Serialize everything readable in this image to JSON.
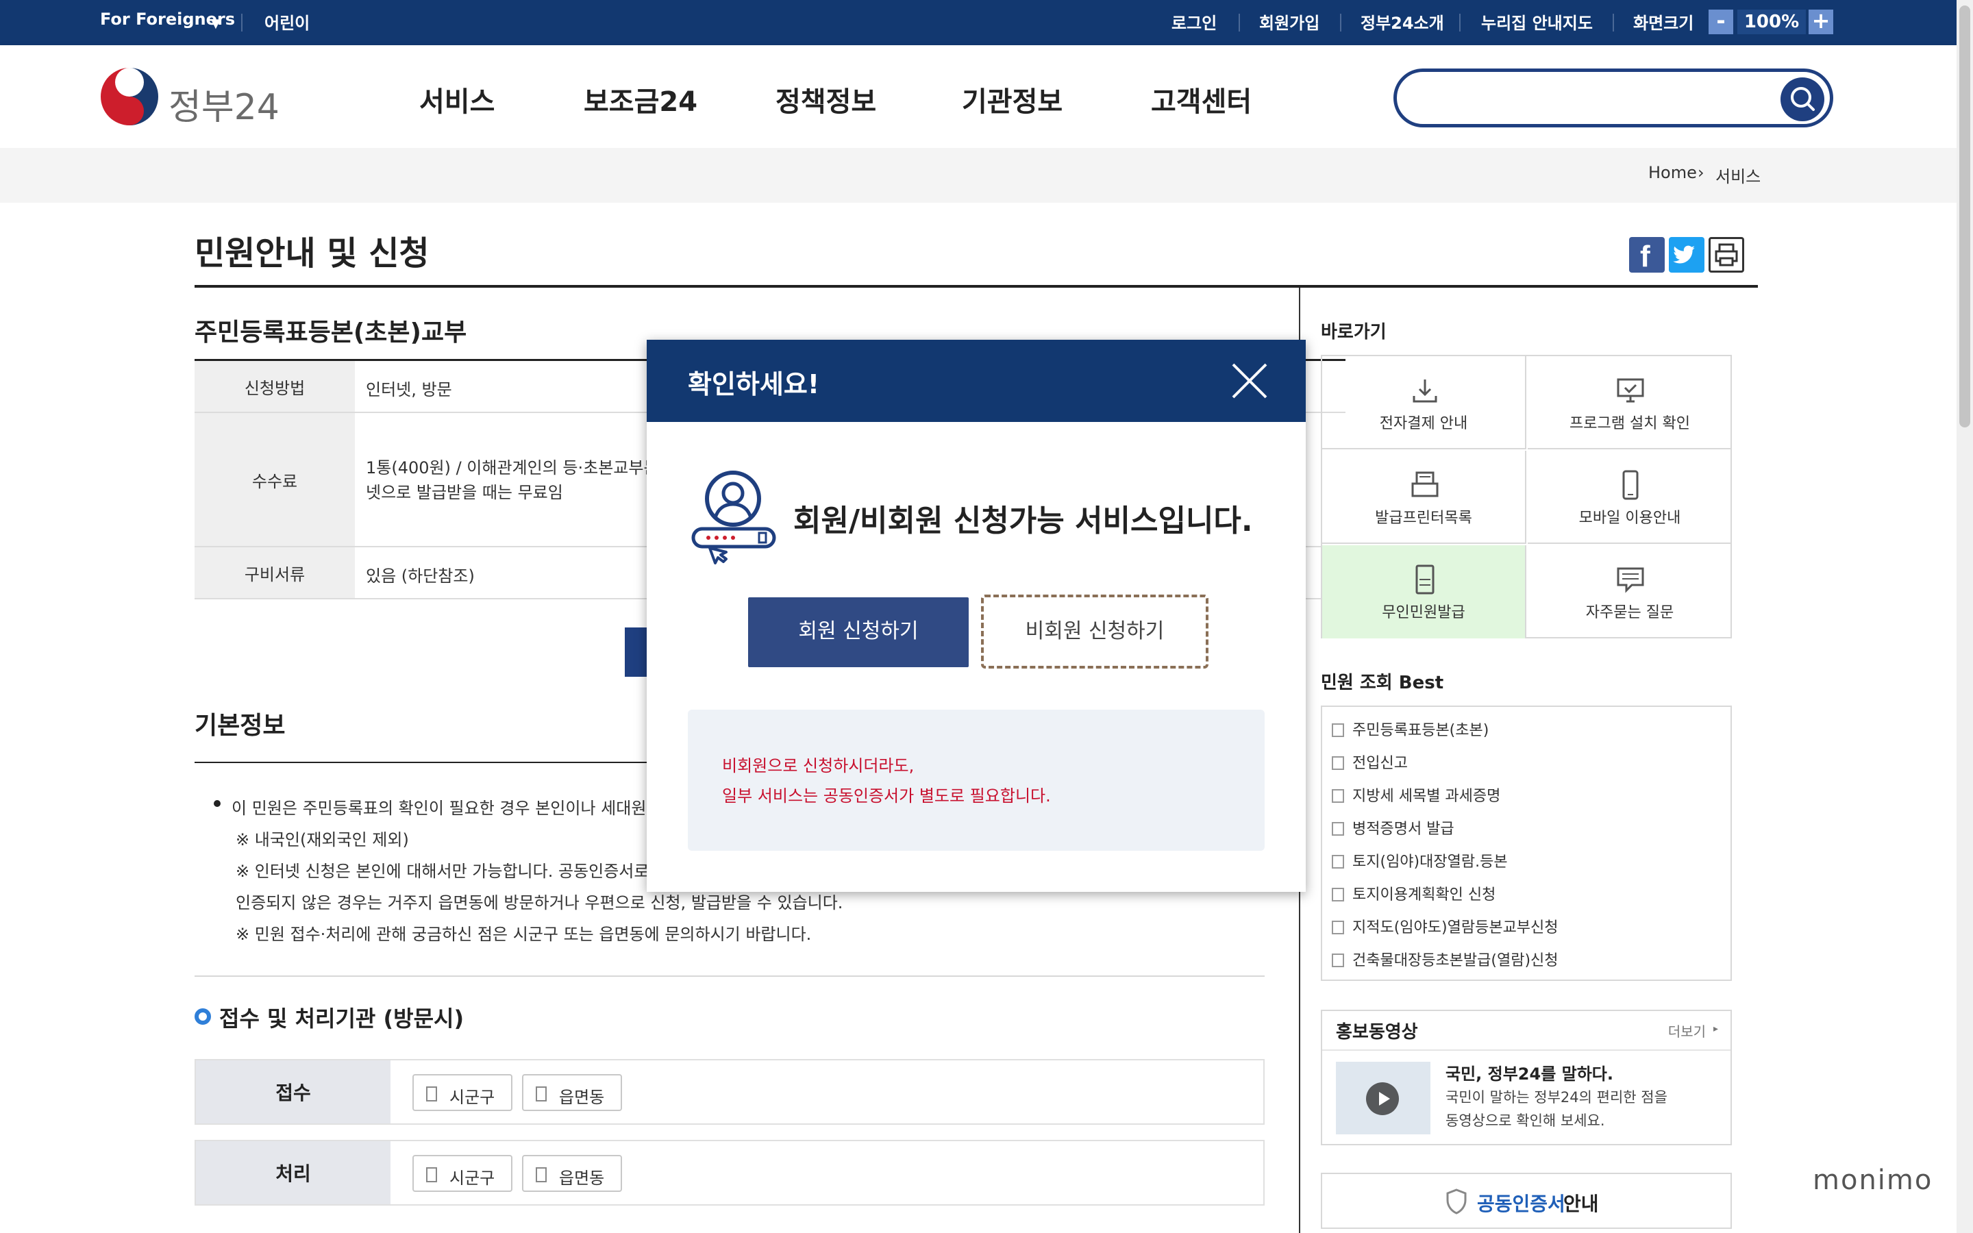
{
  "topbar": {
    "for_foreigners": "For Foreigners",
    "kids": "어린이",
    "login": "로그인",
    "signup": "회원가입",
    "about": "정부24소개",
    "sitemap": "누리집 안내지도",
    "zoom_label": "화면크기",
    "zoom_minus": "-",
    "zoom_value": "100%",
    "zoom_plus": "+"
  },
  "header": {
    "logo_text": "정부24",
    "nav": [
      "서비스",
      "보조금24",
      "정책정보",
      "기관정보",
      "고객센터"
    ],
    "search_placeholder": ""
  },
  "breadcrumb": {
    "home": "Home",
    "current": "서비스"
  },
  "page": {
    "title": "민원안내 및 신청",
    "service_title": "주민등록표등본(초본)교부",
    "rows": [
      {
        "th": "신청방법",
        "td": "인터넷, 방문"
      },
      {
        "th": "수수료",
        "td_line1": "1통(400원) / 이해관계인의 등·초본교부는 500",
        "td_line2": "넷으로 발급받을 때는 무료임"
      },
      {
        "th": "구비서류",
        "td": "있음 (하단참조)"
      }
    ],
    "basic_info_title": "기본정보",
    "basic_info_lines": [
      "이 민원은 주민등록표의 확인이 필요한 경우 본인이나 세대원 및 정당",
      "※ 내국인(재외국인 제외)",
      "※ 인터넷 신청은 본인에 대해서만 가능합니다. 공동인증서로 본인 인",
      "인증되지 않은 경우는 거주지 읍면동에 방문하거나 우편으로 신청, 발급받을 수 있습니다.",
      "※ 민원 접수·처리에 관해 궁금하신 점은 시군구 또는 읍면동에 문의하시기 바랍니다."
    ],
    "agency_title": "접수 및 처리기관 (방문시)",
    "agency_rows": [
      {
        "th": "접수",
        "chips": [
          "시군구",
          "읍면동"
        ]
      },
      {
        "th": "처리",
        "chips": [
          "시군구",
          "읍면동"
        ]
      }
    ]
  },
  "sidebar": {
    "shortcut_title": "바로가기",
    "shortcuts": [
      {
        "label": "전자결제 안내",
        "icon": "download-icon"
      },
      {
        "label": "프로그램 설치 확인",
        "icon": "monitor-icon"
      },
      {
        "label": "발급프린터목록",
        "icon": "printer-icon"
      },
      {
        "label": "모바일 이용안내",
        "icon": "mobile-icon"
      },
      {
        "label": "무인민원발급",
        "icon": "kiosk-icon"
      },
      {
        "label": "자주묻는 질문",
        "icon": "chat-icon"
      }
    ],
    "best_title": "민원 조회 Best",
    "best_items": [
      "주민등록표등본(초본)",
      "전입신고",
      "지방세 세목별 과세증명",
      "병적증명서 발급",
      "토지(임야)대장열람.등본",
      "토지이용계획확인 신청",
      "지적도(임야도)열람등본교부신청",
      "건축물대장등초본발급(열람)신청"
    ],
    "promo_title": "홍보동영상",
    "promo_more": "더보기",
    "promo_heading": "국민, 정부24를 말하다.",
    "promo_desc1": "국민이 말하는 정부24의 편리한 점을",
    "promo_desc2": "동영상으로 확인해 보세요.",
    "cert_highlight": "공동인증서",
    "cert_rest": " 안내"
  },
  "modal": {
    "title": "확인하세요!",
    "message": "회원/비회원 신청가능 서비스입니다.",
    "member_button": "회원 신청하기",
    "guest_button": "비회원 신청하기",
    "notice_line1": "비회원으로 신청하시더라도,",
    "notice_line2": "일부 서비스는 공동인증서가 별도로 필요합니다."
  },
  "watermark": "monimo",
  "colors": {
    "primary": "#123870",
    "accent_blue": "#1f3f80",
    "notice_red": "#c8102e",
    "kiosk_bg": "#e1f7de"
  }
}
